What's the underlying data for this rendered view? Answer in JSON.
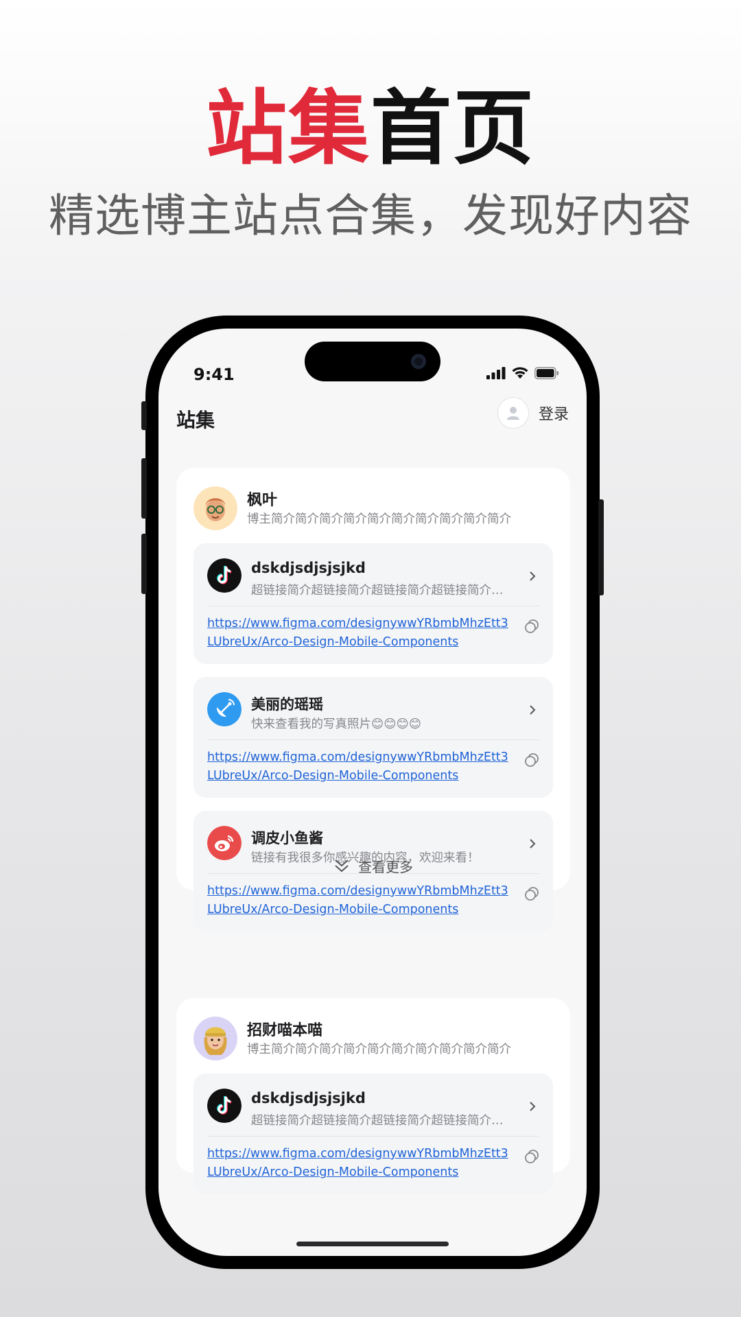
{
  "hero": {
    "title_accent": "站集",
    "title_rest": "首页",
    "subtitle": "精选博主站点合集，发现好内容"
  },
  "status_bar": {
    "time": "9:41"
  },
  "header": {
    "title": "站集",
    "login_label": "登录"
  },
  "colors": {
    "accent": "#e02a3a",
    "link": "#1f63d7",
    "card_bg": "#f4f5f7"
  },
  "blogger1": {
    "name": "枫叶",
    "bio": "博主简介简介简介简介简介简介简介简介简介简介",
    "avatar_icon": "memoji-man-avatar",
    "links": [
      {
        "icon": "tiktok-icon",
        "name": "dskdjsdjsjsjkd",
        "desc": "超链接简介超链接简介超链接简介超链接简介超链接简介",
        "url": "https://www.figma.com/designywwYRbmbMhzEtt3LUbreUx/Arco-Design-Mobile-Components"
      },
      {
        "icon": "satellite-dish-icon",
        "name": "美丽的瑶瑶",
        "desc": "快来查看我的写真照片😊😊😊😊",
        "url": "https://www.figma.com/designywwYRbmbMhzEtt3LUbreUx/Arco-Design-Mobile-Components"
      },
      {
        "icon": "weibo-icon",
        "name": "调皮小鱼酱",
        "desc": "链接有我很多你感兴趣的内容，欢迎来看！",
        "url": "https://www.figma.com/designywwYRbmbMhzEtt3LUbreUx/Arco-Design-Mobile-Components"
      }
    ],
    "more_label": "查看更多"
  },
  "blogger2": {
    "name": "招财喵本喵",
    "bio": "博主简介简介简介简介简介简介简介简介简介简介",
    "avatar_icon": "memoji-woman-avatar",
    "links": [
      {
        "icon": "tiktok-icon",
        "name": "dskdjsdjsjsjkd",
        "desc": "超链接简介超链接简介超链接简介超链接简介超链接简介",
        "url": "https://www.figma.com/designywwYRbmbMhzEtt3LUbreUx/Arco-Design-Mobile-Components"
      }
    ]
  }
}
